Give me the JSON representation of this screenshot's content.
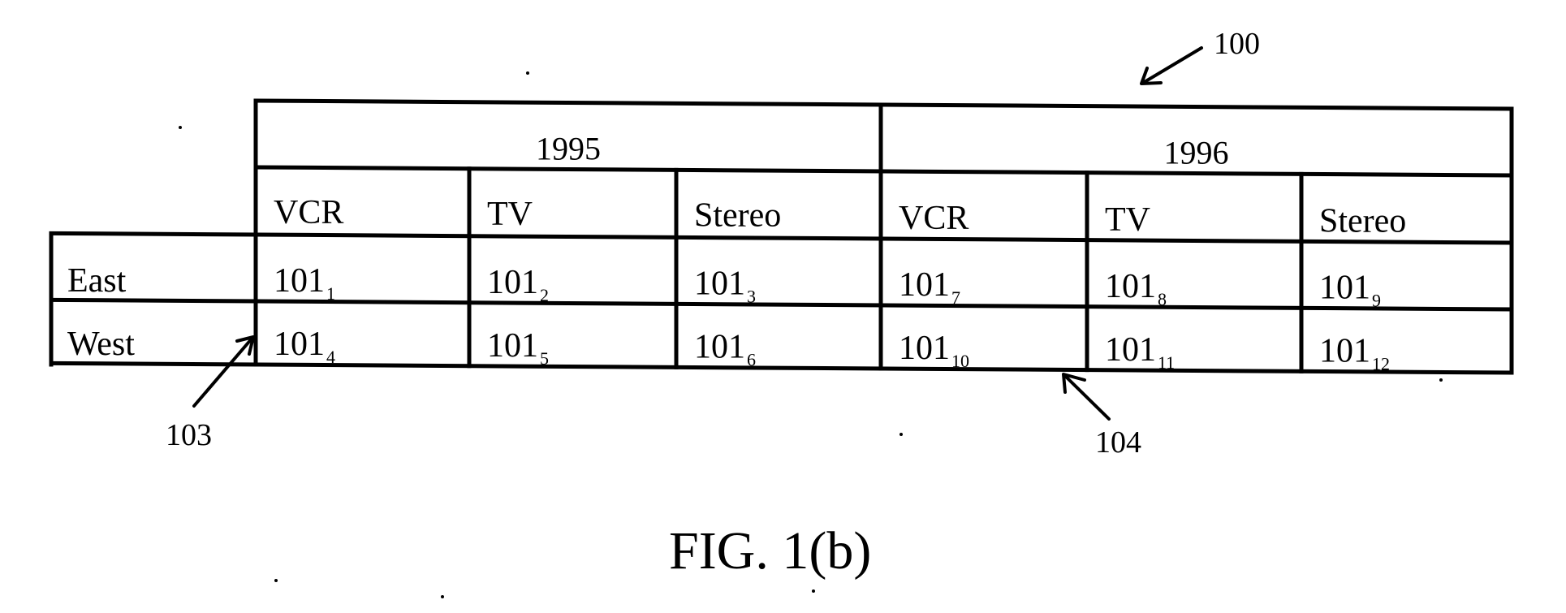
{
  "figure": {
    "caption": "FIG. 1(b)",
    "reference_numerals": {
      "table": "100",
      "row_header_arrow": "103",
      "cell_boundary_arrow": "104"
    },
    "table": {
      "years": [
        "1995",
        "1996"
      ],
      "products": [
        "VCR",
        "TV",
        "Stereo"
      ],
      "rows": [
        {
          "label": "East",
          "cells": [
            {
              "base": "101",
              "sub": "1"
            },
            {
              "base": "101",
              "sub": "2"
            },
            {
              "base": "101",
              "sub": "3"
            },
            {
              "base": "101",
              "sub": "7"
            },
            {
              "base": "101",
              "sub": "8"
            },
            {
              "base": "101",
              "sub": "9"
            }
          ]
        },
        {
          "label": "West",
          "cells": [
            {
              "base": "101",
              "sub": "4"
            },
            {
              "base": "101",
              "sub": "5"
            },
            {
              "base": "101",
              "sub": "6"
            },
            {
              "base": "101",
              "sub": "10"
            },
            {
              "base": "101",
              "sub": "11"
            },
            {
              "base": "101",
              "sub": "12"
            }
          ]
        }
      ]
    }
  }
}
